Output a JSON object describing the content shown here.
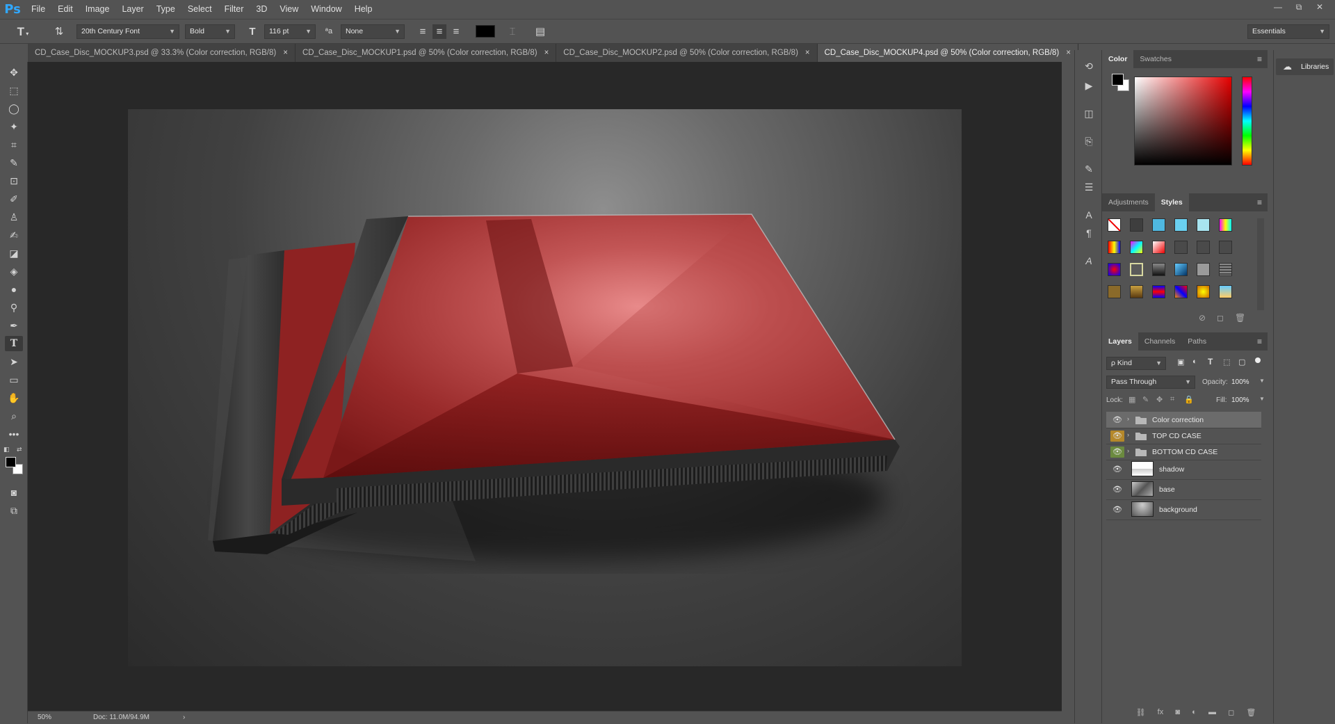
{
  "app": {
    "logo": "Ps"
  },
  "menu": [
    "File",
    "Edit",
    "Image",
    "Layer",
    "Type",
    "Select",
    "Filter",
    "3D",
    "View",
    "Window",
    "Help"
  ],
  "window_controls": {
    "minimize": "—",
    "restore": "⧉",
    "close": "✕"
  },
  "options": {
    "tool_glyph": "T",
    "font_family": "20th Century Font",
    "font_style": "Bold",
    "font_size": "116 pt",
    "aa_label": "ªa",
    "antialias": "None",
    "text_color": "#000000",
    "workspace": "Essentials"
  },
  "tabs": [
    {
      "label": "CD_Case_Disc_MOCKUP3.psd @ 33.3% (Color correction, RGB/8)",
      "active": false
    },
    {
      "label": "CD_Case_Disc_MOCKUP1.psd @ 50% (Color correction, RGB/8)",
      "active": false
    },
    {
      "label": "CD_Case_Disc_MOCKUP2.psd @ 50% (Color correction, RGB/8)",
      "active": false
    },
    {
      "label": "CD_Case_Disc_MOCKUP4.psd @ 50% (Color correction, RGB/8)",
      "active": true
    }
  ],
  "tab_close": "×",
  "status": {
    "zoom": "50%",
    "doc": "Doc: 11.0M/94.9M",
    "arrow": "›"
  },
  "color_panel": {
    "tabs": [
      "Color",
      "Swatches"
    ],
    "foreground": "#000000",
    "background": "#ffffff",
    "hue_color": "#e60000"
  },
  "styles_panel": {
    "tabs": [
      "Adjustments",
      "Styles"
    ]
  },
  "layers_panel": {
    "tabs": [
      "Layers",
      "Channels",
      "Paths"
    ],
    "filter": "ρ Kind",
    "blend_mode": "Pass Through",
    "opacity_label": "Opacity:",
    "opacity": "100%",
    "lock_label": "Lock:",
    "fill_label": "Fill:",
    "fill": "100%",
    "layers": [
      {
        "name": "Color correction",
        "type": "group",
        "eye": "plain",
        "selected": true
      },
      {
        "name": "TOP CD CASE",
        "type": "group",
        "eye": "yellow",
        "selected": false
      },
      {
        "name": "BOTTOM CD CASE",
        "type": "group",
        "eye": "green",
        "selected": false
      },
      {
        "name": "shadow",
        "type": "layer",
        "eye": "plain",
        "selected": false
      },
      {
        "name": "base",
        "type": "layer",
        "eye": "plain",
        "selected": false
      },
      {
        "name": "background",
        "type": "layer",
        "eye": "plain",
        "selected": false
      }
    ]
  },
  "libraries": {
    "label": "Libraries"
  }
}
